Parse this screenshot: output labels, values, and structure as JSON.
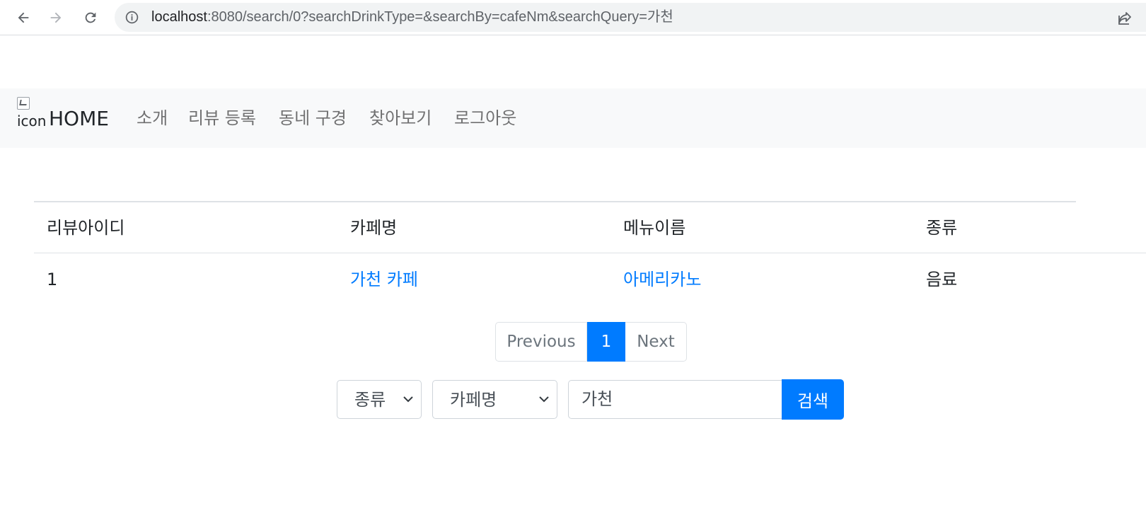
{
  "browser": {
    "url_host": "localhost",
    "url_rest": ":8080/search/0?searchDrinkType=&searchBy=cafeNm&searchQuery=가천"
  },
  "navbar": {
    "brand_img_alt": "icon",
    "brand_text": "HOME",
    "links": [
      "소개",
      "리뷰 등록",
      "동네 구경",
      "찾아보기",
      "로그아웃"
    ]
  },
  "table": {
    "headers": [
      "리뷰아이디",
      "카페명",
      "메뉴이름",
      "종류"
    ],
    "rows": [
      [
        "1",
        "가천 카페",
        "아메리카노",
        "음료"
      ]
    ]
  },
  "pagination": {
    "previous": "Previous",
    "current": "1",
    "next": "Next"
  },
  "search": {
    "drink_type_selected": "종류",
    "search_by_selected": "카페명",
    "query_value": "가천",
    "button_label": "검색"
  },
  "colors": {
    "primary": "#007bff",
    "navbar_bg": "#f8f9fa",
    "muted": "#6c757d"
  }
}
